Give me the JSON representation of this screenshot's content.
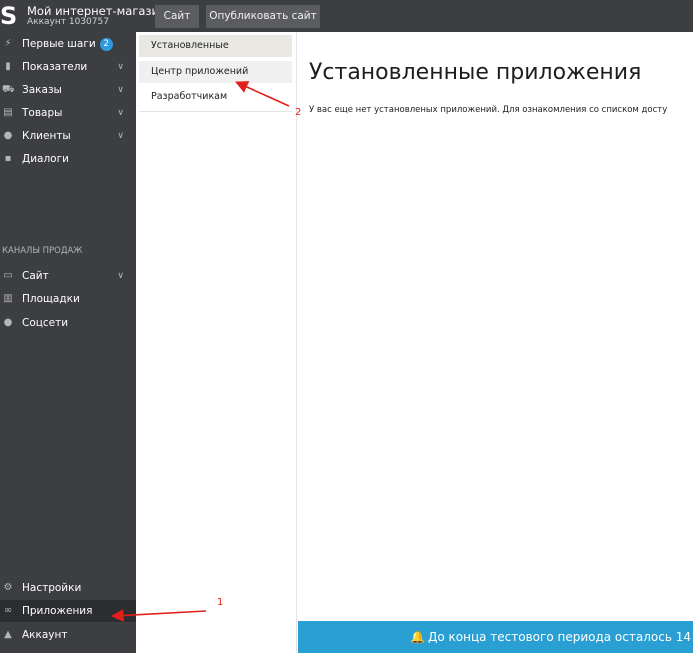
{
  "header": {
    "logo": "S",
    "shop_title": "Мой интернет-магазин",
    "account": "Аккаунт 1030757",
    "site_button": "Сайт",
    "publish_button": "Опубликовать сайт"
  },
  "sidebar": {
    "items": [
      {
        "label": "Первые шаги",
        "badge": "2",
        "icon": "bolt-icon"
      },
      {
        "label": "Показатели",
        "icon": "bar-chart-icon"
      },
      {
        "label": "Заказы",
        "icon": "cart-icon"
      },
      {
        "label": "Товары",
        "icon": "book-icon"
      },
      {
        "label": "Клиенты",
        "icon": "users-icon"
      },
      {
        "label": "Диалоги",
        "icon": "chat-icon"
      }
    ],
    "section_title": "КАНАЛЫ ПРОДАЖ",
    "channels": [
      {
        "label": "Сайт",
        "icon": "monitor-icon"
      },
      {
        "label": "Площадки",
        "icon": "marketplace-icon"
      },
      {
        "label": "Соцсети",
        "icon": "people-icon"
      }
    ],
    "bottom": [
      {
        "label": "Настройки",
        "icon": "gear-icon"
      },
      {
        "label": "Приложения",
        "icon": "link-icon"
      },
      {
        "label": "Аккаунт",
        "icon": "user-icon"
      }
    ]
  },
  "submenu": {
    "items": [
      "Установленные",
      "Центр приложений",
      "Разработчикам"
    ]
  },
  "main": {
    "title": "Установленные приложения",
    "text": "У вас еще нет установленых приложений. Для ознакомления со списком досту"
  },
  "banner": {
    "text": "До конца тестового периода осталось 14"
  },
  "annotations": {
    "label_1": "1",
    "label_2": "2",
    "color": "#e0201a"
  },
  "colors": {
    "sidebar": "#3d3e42",
    "active_sidebar": "#2c2d30",
    "banner": "#2a9fd3",
    "badge": "#2f9ae0"
  }
}
